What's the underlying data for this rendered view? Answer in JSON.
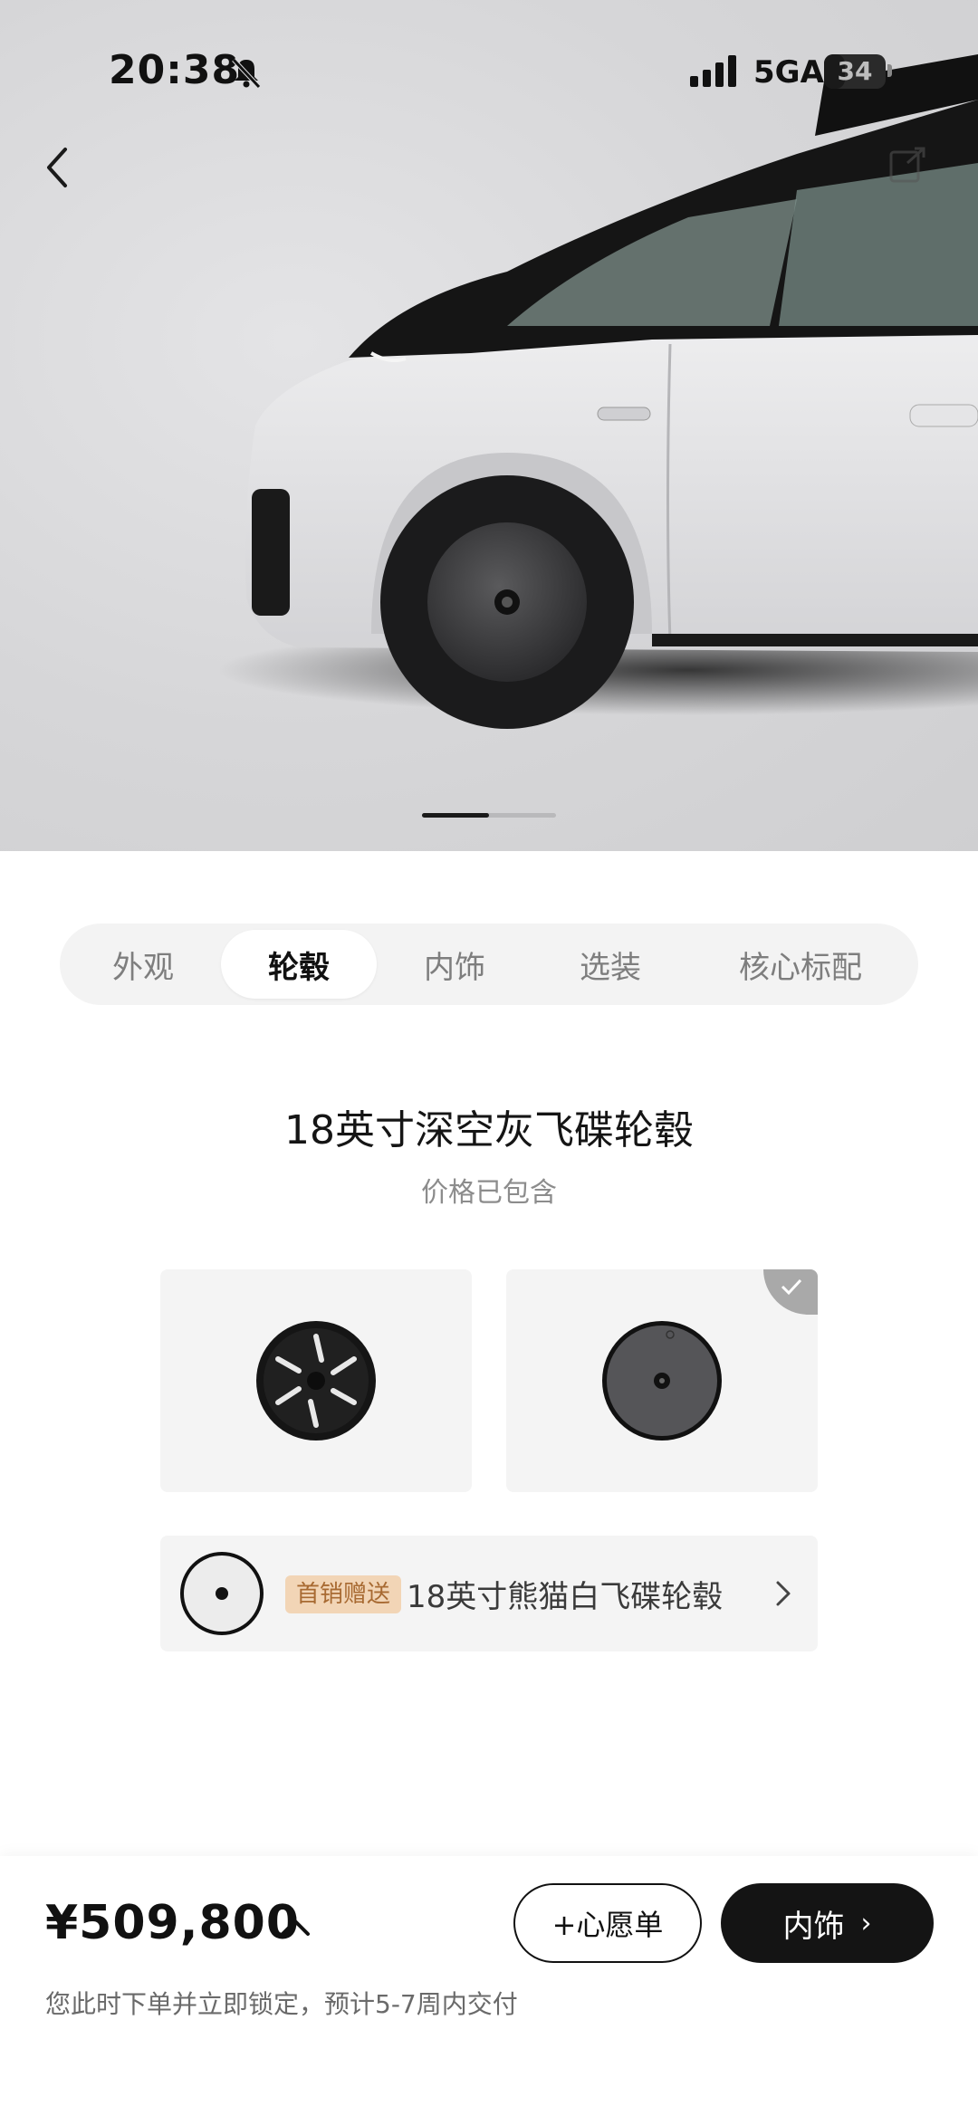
{
  "status_bar": {
    "time": "20:38",
    "network": "5GA",
    "battery": "34",
    "battery_level": 0.34
  },
  "hero": {
    "carousel_page": 1,
    "carousel_pages": 2
  },
  "tabs": [
    {
      "label": "外观",
      "active": false
    },
    {
      "label": "轮毂",
      "active": true
    },
    {
      "label": "内饰",
      "active": false
    },
    {
      "label": "选装",
      "active": false
    },
    {
      "label": "核心标配",
      "active": false
    }
  ],
  "option": {
    "title": "18英寸深空灰飞碟轮毂",
    "subtitle": "价格已包含",
    "selected_index": 1
  },
  "gift": {
    "badge": "首销赠送",
    "label": "18英寸熊猫白飞碟轮毂"
  },
  "bottom": {
    "price": "¥509,800",
    "delivery_note": "您此时下单并立即锁定，预计5-7周内交付",
    "wishlist_label": "+心愿单",
    "next_label": "内饰"
  },
  "colors": {
    "accent": "#141414",
    "badge_bg": "#f2d5b6",
    "badge_text": "#a86a32"
  }
}
